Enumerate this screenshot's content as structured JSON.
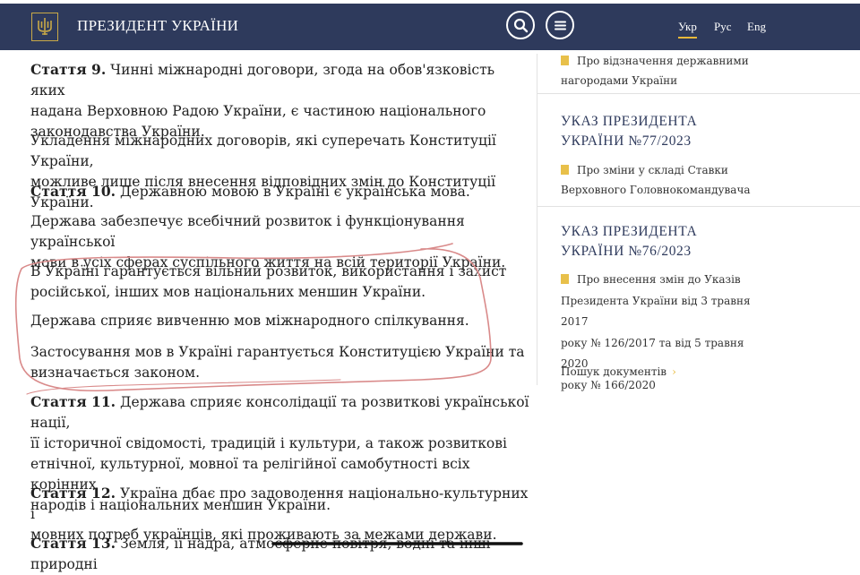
{
  "header": {
    "title": "ПРЕЗИДЕНТ УКРАЇНИ",
    "languages": [
      "Укр",
      "Рус",
      "Eng"
    ],
    "active_language": "Укр",
    "colors": {
      "bar": "#2e3a5c",
      "accent": "#e8b93a"
    }
  },
  "article": {
    "paragraphs": [
      {
        "label": "Стаття 9.",
        "lines": [
          " Чинні міжнародні договори, згода на обов'язковість яких",
          "надана Верховною Радою України, є частиною національного",
          "законодавства України."
        ]
      },
      {
        "label": "",
        "lines": [
          "Укладення міжнародних договорів, які суперечать Конституції України,",
          "можливе лише після внесення відповідних змін до Конституції України."
        ]
      },
      {
        "label": "Стаття 10.",
        "lines": [
          " Державною мовою в Україні є українська мова."
        ]
      },
      {
        "label": "",
        "lines": [
          "Держава забезпечує всебічний розвиток і функціонування української",
          "мови в усіх сферах суспільного життя на всій території України."
        ]
      },
      {
        "label": "",
        "lines": [
          "В Україні гарантується вільний розвиток, використання і захист",
          "російської, інших мов національних меншин України."
        ]
      },
      {
        "label": "",
        "lines": [
          "Держава сприяє вивченню мов міжнародного спілкування."
        ]
      },
      {
        "label": "",
        "lines": [
          "Застосування мов в Україні гарантується Конституцією України та",
          "визначається законом."
        ]
      },
      {
        "label": "Стаття 11.",
        "lines": [
          " Держава сприяє консолідації та розвиткові української нації,",
          "її історичної свідомості, традицій і культури, а також розвиткові",
          "етнічної, культурної, мовної та релігійної самобутності всіх корінних",
          "народів і національних меншин України."
        ]
      },
      {
        "label": "Стаття 12.",
        "lines": [
          " Україна дбає про задоволення національно-культурних і",
          "мовних потреб українців, які проживають за межами держави."
        ]
      },
      {
        "label": "Стаття 13.",
        "lines": [
          " Земля, її надра, атмосферне повітря, водні та інші природні"
        ]
      }
    ]
  },
  "sidebar": {
    "first_link": [
      "Про відзначення державними",
      "нагородами України"
    ],
    "decrees": [
      {
        "heading": [
          "УКАЗ ПРЕЗИДЕНТА",
          "УКРАЇНИ №77/2023"
        ],
        "link": [
          "Про зміни у складі Ставки",
          "Верховного Головнокомандувача"
        ]
      },
      {
        "heading": [
          "УКАЗ ПРЕЗИДЕНТА",
          "УКРАЇНИ №76/2023"
        ],
        "link": [
          "Про внесення змін до Указів",
          "Президента України від 3 травня 2017",
          "року № 126/2017 та від 5 травня 2020",
          "року № 166/2020"
        ]
      }
    ],
    "search_link": "Пошук документів",
    "icon_color": "#e8c04a"
  },
  "annotation": {
    "color": "#d98a8a"
  }
}
